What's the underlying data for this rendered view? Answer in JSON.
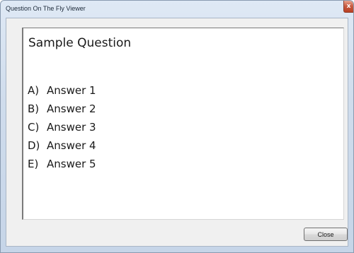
{
  "window": {
    "title": "Question On The Fly Viewer",
    "close_glyph": "x"
  },
  "question": {
    "text": "Sample Question",
    "answers": [
      {
        "letter": "A)",
        "text": "Answer 1"
      },
      {
        "letter": "B)",
        "text": "Answer 2"
      },
      {
        "letter": "C)",
        "text": "Answer 3"
      },
      {
        "letter": "D)",
        "text": "Answer 4"
      },
      {
        "letter": "E)",
        "text": "Answer 5"
      }
    ]
  },
  "footer": {
    "close_label": "Close"
  },
  "icons": {
    "window_close": "close-icon"
  },
  "colors": {
    "titlebar": "#cfdcec",
    "close_button": "#c75a3f",
    "client_background": "#f0f0f0",
    "content_background": "#ffffff"
  }
}
